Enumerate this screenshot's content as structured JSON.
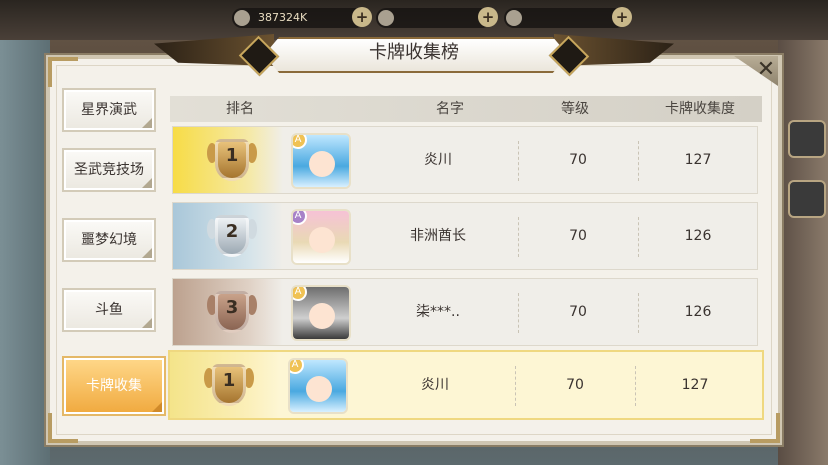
{
  "hud": {
    "gold_value": "387324K",
    "plus_label": "+"
  },
  "title": "卡牌收集榜",
  "close_label": "✕",
  "tabs": [
    {
      "label": "星界演武"
    },
    {
      "label": "圣武竞技场"
    },
    {
      "label": "噩梦幻境"
    },
    {
      "label": "斗鱼"
    },
    {
      "label": "卡牌收集",
      "active": true
    }
  ],
  "table": {
    "headers": {
      "rank": "排名",
      "name": "名字",
      "level": "等级",
      "score": "卡牌收集度"
    },
    "rows": [
      {
        "rank": "1",
        "name": "炎川",
        "level": "70",
        "score": "127",
        "medal": "gold",
        "avatar": "a1",
        "badge": "A"
      },
      {
        "rank": "2",
        "name": "非洲酋长",
        "level": "70",
        "score": "126",
        "medal": "silver",
        "avatar": "a2",
        "badge": "A"
      },
      {
        "rank": "3",
        "name": "柒***..",
        "level": "70",
        "score": "126",
        "medal": "bronze",
        "avatar": "a3",
        "badge": "A"
      }
    ],
    "self": {
      "rank": "1",
      "name": "炎川",
      "level": "70",
      "score": "127",
      "medal": "gold",
      "avatar": "a1",
      "badge": "A"
    }
  }
}
